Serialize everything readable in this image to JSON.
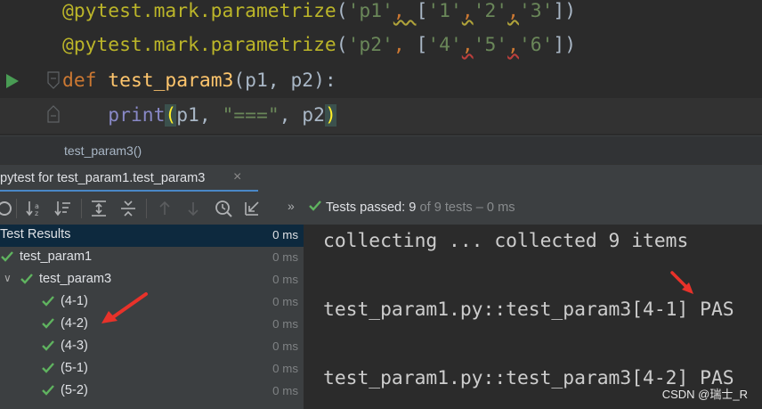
{
  "editor": {
    "line1": {
      "decorator": "@pytest.mark.parametrize",
      "open": "(",
      "name": "'p1'",
      "comma": ", ",
      "lb": "[",
      "a": "'1'",
      "c1": ",",
      "b": "'2'",
      "c2": ",",
      "c": "'3'",
      "rb": "])"
    },
    "line2": {
      "decorator": "@pytest.mark.parametrize",
      "open": "(",
      "name": "'p2'",
      "comma": ", ",
      "lb": "[",
      "a": "'4'",
      "c1": ",",
      "b": "'5'",
      "c2": ",",
      "c": "'6'",
      "rb": "])"
    },
    "line3": {
      "kw": "def",
      "fn": "test_param3",
      "sig": "(p1, p2):"
    },
    "line4": {
      "indent": "    ",
      "call": "print",
      "lp": "(",
      "arg1": "p1, ",
      "str": "\"===\"",
      "arg2": ", p2",
      "rp": ")"
    }
  },
  "breadcrumb": "test_param3()",
  "run_tab": {
    "label": "pytest for test_param1.test_param3",
    "close": "×"
  },
  "toolbar": {
    "status_label": "Tests passed:",
    "passed": "9",
    "total_text": "of 9 tests – 0 ms",
    "more": "»"
  },
  "tree": [
    {
      "label": "Test Results",
      "time": "0 ms",
      "level": 0,
      "selected": true,
      "check": false,
      "twisty": ""
    },
    {
      "label": "test_param1",
      "time": "0 ms",
      "level": 0,
      "selected": false,
      "check": true,
      "twisty": ""
    },
    {
      "label": "test_param3",
      "time": "0 ms",
      "level": 1,
      "selected": false,
      "check": true,
      "twisty": "∨"
    },
    {
      "label": "(4-1)",
      "time": "0 ms",
      "level": 2,
      "selected": false,
      "check": true,
      "twisty": ""
    },
    {
      "label": "(4-2)",
      "time": "0 ms",
      "level": 2,
      "selected": false,
      "check": true,
      "twisty": ""
    },
    {
      "label": "(4-3)",
      "time": "0 ms",
      "level": 2,
      "selected": false,
      "check": true,
      "twisty": ""
    },
    {
      "label": "(5-1)",
      "time": "0 ms",
      "level": 2,
      "selected": false,
      "check": true,
      "twisty": ""
    },
    {
      "label": "(5-2)",
      "time": "0 ms",
      "level": 2,
      "selected": false,
      "check": true,
      "twisty": ""
    }
  ],
  "console": [
    "collecting ... collected 9 items",
    "",
    "test_param1.py::test_param3[4-1] PAS",
    "",
    "test_param1.py::test_param3[4-2] PAS"
  ],
  "watermark": "CSDN @瑞士_R",
  "colors": {
    "accent": "#4a88c7",
    "pass": "#5fb35f",
    "annotation": "#e8322a"
  },
  "icons": [
    "run-gutter-icon",
    "fold-icon",
    "rerun-icon",
    "sort-alpha-icon",
    "sort-duration-icon",
    "expand-all-icon",
    "collapse-all-icon",
    "prev-fail-icon",
    "next-fail-icon",
    "history-icon",
    "export-icon",
    "check-icon",
    "red-arrow-icon"
  ]
}
